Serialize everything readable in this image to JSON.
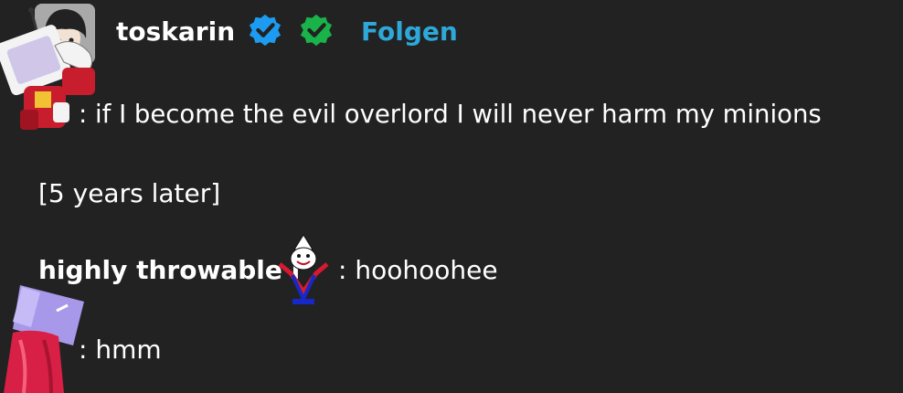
{
  "post": {
    "author": {
      "username": "toskarin",
      "follow_label": "Folgen",
      "badges": [
        {
          "icon": "verified-check-icon",
          "color": "#1d9bf0"
        },
        {
          "icon": "verified-check-icon",
          "color": "#19b34a"
        }
      ]
    },
    "lines": [
      {
        "speaker": "",
        "text": ": if I become the evil overlord I will never harm my minions"
      },
      {
        "speaker": "",
        "text": "[5 years later]"
      },
      {
        "speaker": "highly throwable i",
        "text": ": hoohoohee"
      },
      {
        "speaker": "",
        "text": ": hmm"
      }
    ]
  },
  "colors": {
    "background": "#222222",
    "text": "#ffffff",
    "link": "#2da8d8"
  }
}
